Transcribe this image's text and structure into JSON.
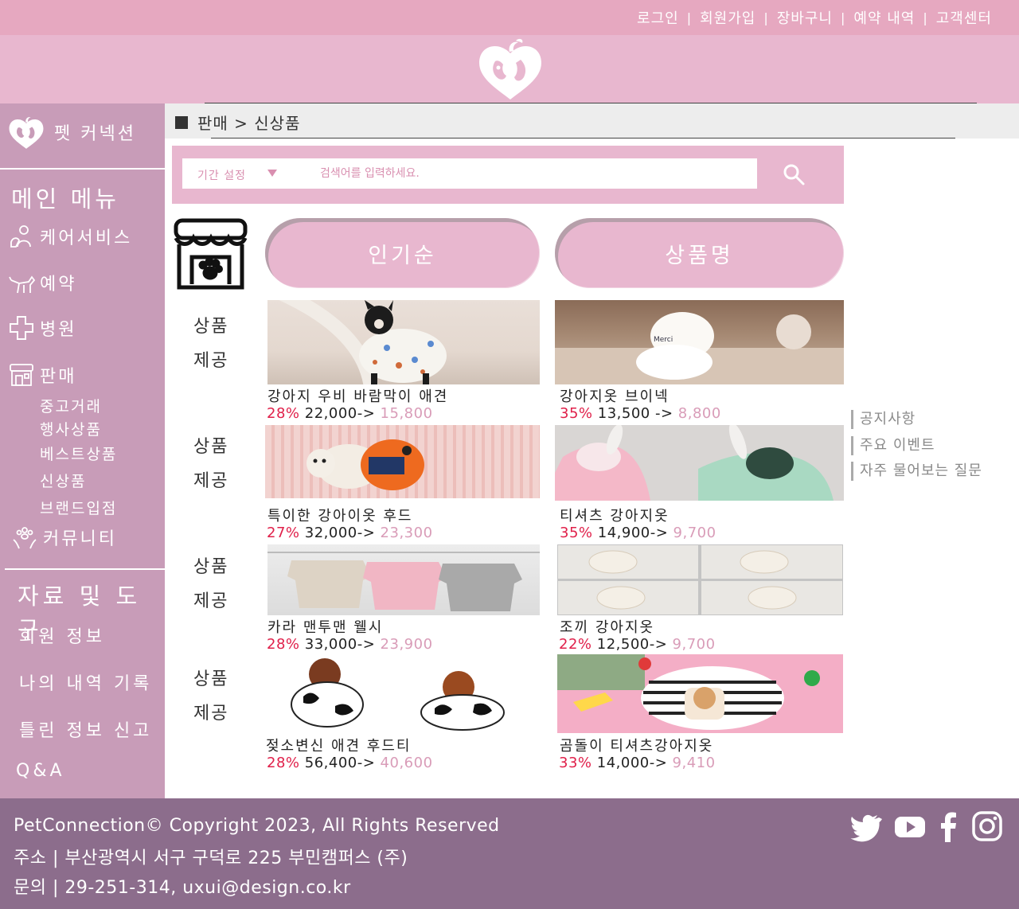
{
  "top_nav": {
    "items": [
      "로그인",
      "회원가입",
      "장바구니",
      "예약 내역",
      "고객센터"
    ],
    "separator": "|"
  },
  "sidebar": {
    "brand": "펫 커넥션",
    "main_menu_title": "메인 메뉴",
    "items": [
      {
        "label": "케어서비스",
        "icon": "care-service-icon"
      },
      {
        "label": "예약",
        "icon": "dog-icon"
      },
      {
        "label": "병원",
        "icon": "hospital-cross-icon"
      },
      {
        "label": "판매",
        "icon": "store-icon"
      }
    ],
    "sub_items": [
      "중고거래",
      "행사상품",
      "베스트상품",
      "신상품",
      "브랜드입점"
    ],
    "community": {
      "label": "커뮤니티",
      "icon": "community-paw-icon"
    },
    "tools_title": "자료 및 도구",
    "tools": [
      "회원 정보",
      "나의 내역 기록",
      "틀린 정보 신고",
      "Q&A"
    ]
  },
  "breadcrumb": "판매 > 신상품",
  "search": {
    "period_label": "기간 설정",
    "placeholder": "검색어를 입력하세요."
  },
  "sort": {
    "popular": "인기순",
    "name": "상품명"
  },
  "provide_label": [
    "상품",
    "제공"
  ],
  "products": [
    {
      "name": "강아지 우비 바람막이 애견",
      "discount": "28%",
      "price": "22,000->",
      "sale": "15,800"
    },
    {
      "name": "강아지옷 브이넥",
      "discount": "35%",
      "price": "13,500 ->",
      "sale": "8,800"
    },
    {
      "name": "특이한 강아이옷 후드",
      "discount": "27%",
      "price": "32,000->",
      "sale": "23,300"
    },
    {
      "name": "티셔츠 강아지옷",
      "discount": "35%",
      "price": "14,900->",
      "sale": "9,700"
    },
    {
      "name": "카라 맨투맨 웰시",
      "discount": "28%",
      "price": "33,000->",
      "sale": "23,900"
    },
    {
      "name": "조끼 강아지옷",
      "discount": "22%",
      "price": "12,500->",
      "sale": "9,700"
    },
    {
      "name": "젖소변신 애견 후드티",
      "discount": "28%",
      "price": "56,400->",
      "sale": "40,600"
    },
    {
      "name": "곰돌이 티셔츠강아지옷",
      "discount": "33%",
      "price": "14,000->",
      "sale": "9,410"
    }
  ],
  "right_links": [
    "공지사항",
    "주요 이벤트",
    "자주 물어보는 질문"
  ],
  "footer": {
    "copyright": "PetConnection© Copyright 2023, All Rights Reserved",
    "address": "주소 | 부산광역시 서구 구덕로 225 부민캠퍼스 (주)",
    "contact": "문의 | 29-251-314, uxui@design.co.kr",
    "social": [
      "twitter-icon",
      "youtube-icon",
      "facebook-icon",
      "instagram-icon"
    ]
  },
  "colors": {
    "topbar": "#e6a8c0",
    "banner": "#e8b7cf",
    "sidebar": "#c89cb8",
    "footer": "#8c6d8c",
    "discount": "#e0204a",
    "sale_price": "#d99cb8"
  }
}
